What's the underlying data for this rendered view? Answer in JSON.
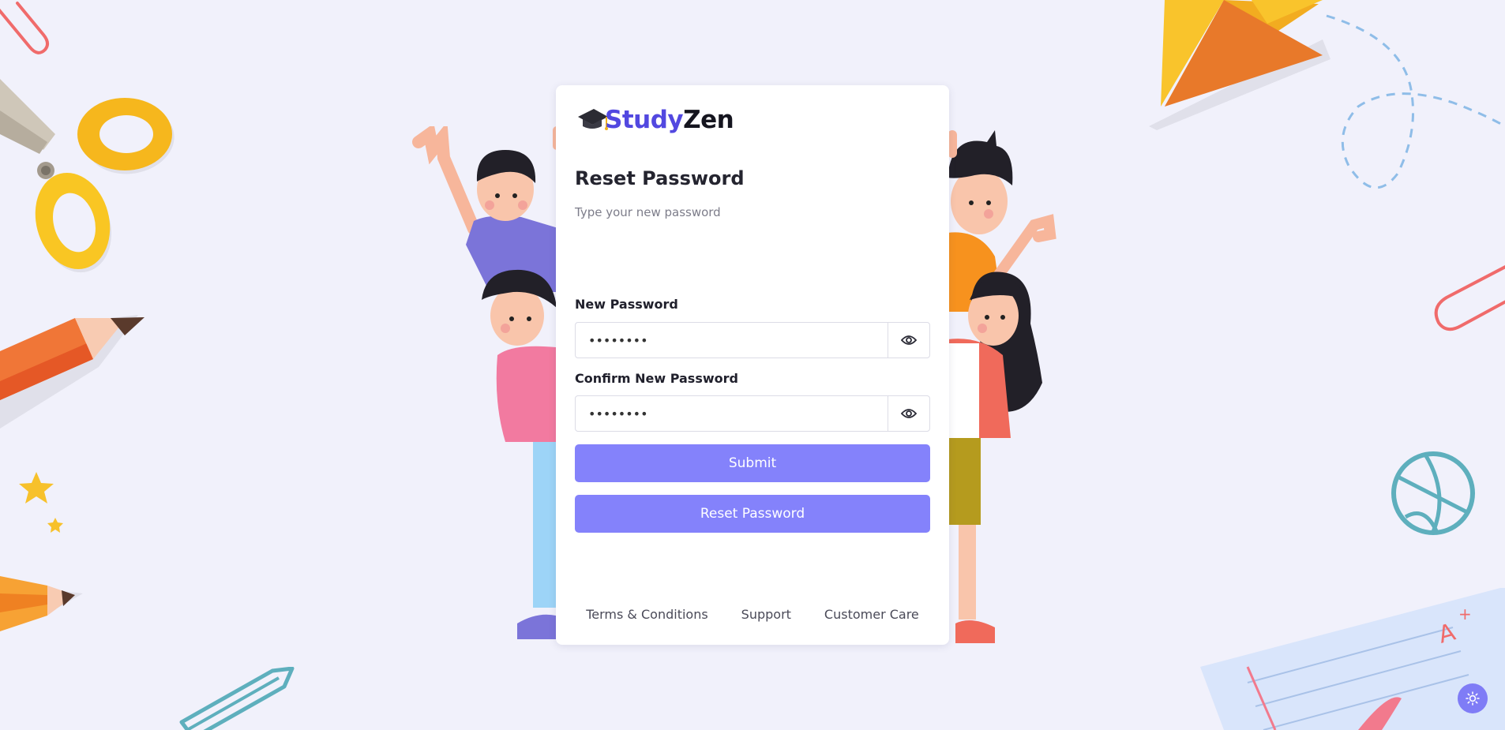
{
  "brand": {
    "name_part1": "Study",
    "name_part2": "Zen"
  },
  "page": {
    "title": "Reset Password",
    "subtitle": "Type your new password"
  },
  "form": {
    "new_password_label": "New Password",
    "new_password_value": "12345678",
    "confirm_password_label": "Confirm New Password",
    "confirm_password_value": "12345678",
    "submit_label": "Submit",
    "reset_label": "Reset Password"
  },
  "footer": {
    "links": [
      "Terms & Conditions",
      "Support",
      "Customer Care"
    ]
  },
  "colors": {
    "background": "#f1f1fb",
    "accent": "#8482fb",
    "brand_primary": "#5248e0"
  },
  "icons": {
    "logo": "graduation-cap-icon",
    "password_toggle": "eye-icon",
    "theme_toggle": "sun-icon"
  }
}
